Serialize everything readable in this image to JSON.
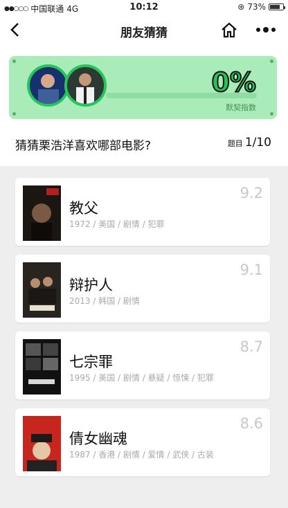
{
  "status": {
    "signal": "●●○○○",
    "carrier": "中国联通",
    "network": "4G",
    "time": "10:12",
    "battery": "73%"
  },
  "nav": {
    "title": "朋友猜猜"
  },
  "quiz": {
    "percent": "0%",
    "tacit_label": "默契指数",
    "progress": 0,
    "question": "猜猜栗浩洋喜欢哪部电影?",
    "qnum_label": "题目",
    "qnum": "1/10"
  },
  "movies": [
    {
      "title": "教父",
      "meta": "1972 / 美国 / 剧情 / 犯罪",
      "score": "9.2"
    },
    {
      "title": "辩护人",
      "meta": "2013 / 韩国 / 剧情",
      "score": "9.1"
    },
    {
      "title": "七宗罪",
      "meta": "1995 / 美国 / 剧情 / 悬疑 / 惊悚 / 犯罪",
      "score": "8.7"
    },
    {
      "title": "倩女幽魂",
      "meta": "1987 / 香港 / 剧情 / 爱情 / 武侠 / 古装",
      "score": "8.6"
    }
  ],
  "colors": {
    "accent": "#25c25a",
    "panel": "#a9ecb9"
  }
}
